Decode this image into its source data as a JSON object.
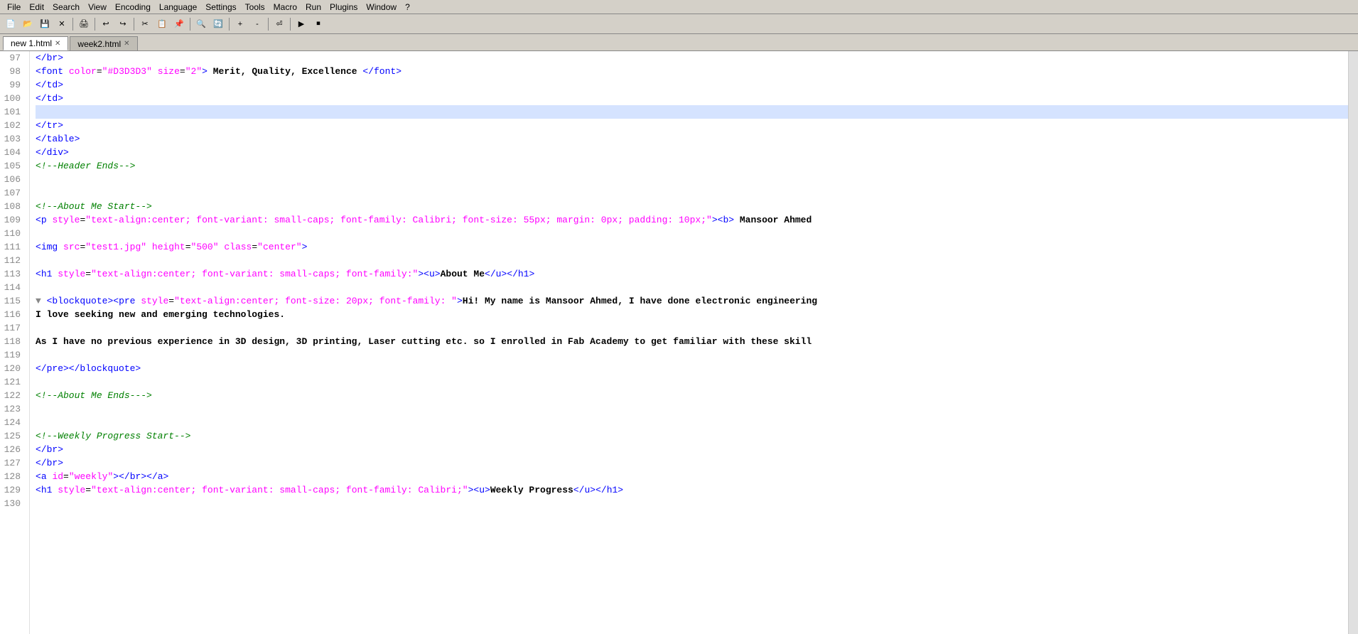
{
  "menubar": {
    "items": [
      "File",
      "Edit",
      "Search",
      "View",
      "Encoding",
      "Language",
      "Settings",
      "Tools",
      "Macro",
      "Run",
      "Plugins",
      "Window",
      "?"
    ]
  },
  "tabs": [
    {
      "label": "new 1.html",
      "active": true,
      "modified": false
    },
    {
      "label": "week2.html",
      "active": false,
      "modified": true
    }
  ],
  "editor": {
    "lines": [
      {
        "num": 97,
        "indent": 3,
        "content": "&lt;/br&gt;",
        "type": "tag"
      },
      {
        "num": 98,
        "indent": 3,
        "content": "&lt;font color=\"#D3D3D3\" size=\"2\"&gt; Merit, Quality, Excellence &lt;/font&gt;",
        "type": "mixed"
      },
      {
        "num": 99,
        "indent": 3,
        "content": "&lt;/td&gt;",
        "type": "tag"
      },
      {
        "num": 100,
        "indent": 3,
        "content": "&lt;/td&gt;",
        "type": "tag"
      },
      {
        "num": 101,
        "indent": 0,
        "content": "",
        "type": "empty",
        "selected": true
      },
      {
        "num": 102,
        "indent": 0,
        "content": "&lt;/tr&gt;",
        "type": "tag"
      },
      {
        "num": 103,
        "indent": 0,
        "content": "&lt;/table&gt;",
        "type": "tag"
      },
      {
        "num": 104,
        "indent": 0,
        "content": "&lt;/div&gt;",
        "type": "tag"
      },
      {
        "num": 105,
        "indent": 0,
        "content": "&lt;!--Header Ends--&gt;",
        "type": "comment"
      },
      {
        "num": 106,
        "indent": 0,
        "content": "",
        "type": "empty"
      },
      {
        "num": 107,
        "indent": 0,
        "content": "",
        "type": "empty"
      },
      {
        "num": 108,
        "indent": 0,
        "content": "&lt;!--About Me Start--&gt;",
        "type": "comment"
      },
      {
        "num": 109,
        "indent": 0,
        "content": "&lt;p style=\"text-align:center; font-variant: small-caps; font-family: Calibri; font-size: 55px; margin: 0px; padding: 10px;\"&gt;&lt;b&gt; Mansoor Ahmed",
        "type": "mixed"
      },
      {
        "num": 110,
        "indent": 0,
        "content": "",
        "type": "empty"
      },
      {
        "num": 111,
        "indent": 0,
        "content": "&lt;img src=\"test1.jpg\" height=\"500\" class=\"center\"&gt;",
        "type": "mixed"
      },
      {
        "num": 112,
        "indent": 0,
        "content": "",
        "type": "empty"
      },
      {
        "num": 113,
        "indent": 0,
        "content": "&lt;h1 style=\"text-align:center; font-variant: small-caps; font-family:\"&gt;&lt;u&gt;About Me&lt;/u&gt;&lt;/h1&gt;",
        "type": "mixed"
      },
      {
        "num": 114,
        "indent": 0,
        "content": "",
        "type": "empty"
      },
      {
        "num": 115,
        "indent": 0,
        "content": "&lt;blockquote&gt;&lt;pre style=\"text-align:center; font-size: 20px; font-family: \"&gt;Hi! My name is Mansoor Ahmed, I have done electronic engineering",
        "type": "mixed",
        "fold": true
      },
      {
        "num": 116,
        "indent": 0,
        "content": "I love seeking new and emerging technologies.",
        "type": "bold"
      },
      {
        "num": 117,
        "indent": 0,
        "content": "",
        "type": "empty"
      },
      {
        "num": 118,
        "indent": 0,
        "content": "As I have no previous experience in 3D design, 3D printing, Laser cutting etc. so I enrolled in Fab Academy to get familiar with these skill",
        "type": "bold"
      },
      {
        "num": 119,
        "indent": 0,
        "content": "",
        "type": "empty"
      },
      {
        "num": 120,
        "indent": 0,
        "content": "&lt;/pre&gt;&lt;/blockquote&gt;",
        "type": "tag"
      },
      {
        "num": 121,
        "indent": 0,
        "content": "",
        "type": "empty"
      },
      {
        "num": 122,
        "indent": 0,
        "content": "&lt;!--About Me Ends---&gt;",
        "type": "comment"
      },
      {
        "num": 123,
        "indent": 0,
        "content": "",
        "type": "empty"
      },
      {
        "num": 124,
        "indent": 0,
        "content": "",
        "type": "empty"
      },
      {
        "num": 125,
        "indent": 0,
        "content": "&lt;!--Weekly Progress Start--&gt;",
        "type": "comment"
      },
      {
        "num": 126,
        "indent": 0,
        "content": "&lt;/br&gt;",
        "type": "tag"
      },
      {
        "num": 127,
        "indent": 0,
        "content": "&lt;/br&gt;",
        "type": "tag"
      },
      {
        "num": 128,
        "indent": 0,
        "content": "&lt;a id=\"weekly\"&gt;&lt;/br&gt;&lt;/a&gt;",
        "type": "mixed"
      },
      {
        "num": 129,
        "indent": 0,
        "content": "&lt;h1 style=\"text-align:center; font-variant: small-caps; font-family: Calibri;\"&gt;&lt;u&gt;Weekly Progress&lt;/u&gt;&lt;/h1&gt;",
        "type": "mixed"
      },
      {
        "num": 130,
        "indent": 0,
        "content": "",
        "type": "empty"
      }
    ]
  }
}
